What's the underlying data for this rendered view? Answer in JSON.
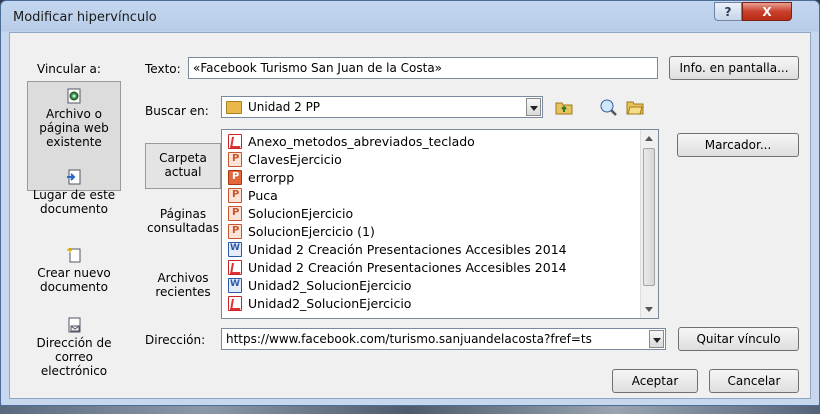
{
  "window": {
    "title": "Modificar hipervínculo",
    "help_label": "?",
    "close_label": "X"
  },
  "link_to": {
    "label": "Vincular a:",
    "items": [
      {
        "label_1": "Archivo o",
        "label_2": "página web",
        "label_3": "existente",
        "icon": "web-file-icon",
        "selected": true
      },
      {
        "label_1": "Lugar de este",
        "label_2": "documento",
        "icon": "document-place-icon",
        "selected": false
      },
      {
        "label_1": "Crear nuevo",
        "label_2": "documento",
        "icon": "new-document-icon",
        "selected": false
      },
      {
        "label_1": "Dirección de",
        "label_2": "correo",
        "label_3": "electrónico",
        "icon": "email-address-icon",
        "selected": false
      }
    ]
  },
  "text_field": {
    "label": "Texto:",
    "value": "«Facebook Turismo San Juan de la Costa»"
  },
  "screentip_button": "Info. en pantalla...",
  "look_in": {
    "label": "Buscar en:",
    "value": "Unidad 2 PP",
    "icons": [
      "up-folder-icon",
      "browse-web-icon",
      "browse-file-icon"
    ]
  },
  "view_tabs": [
    {
      "label_1": "Carpeta",
      "label_2": "actual",
      "selected": true
    },
    {
      "label_1": "Páginas",
      "label_2": "consultadas",
      "selected": false
    },
    {
      "label_1": "Archivos",
      "label_2": "recientes",
      "selected": false
    }
  ],
  "files": [
    {
      "name": "Anexo_metodos_abreviados_teclado",
      "icon": "pdf"
    },
    {
      "name": "ClavesEjercicio",
      "icon": "pptx"
    },
    {
      "name": "errorpp",
      "icon": "ppt"
    },
    {
      "name": "Puca",
      "icon": "pptx"
    },
    {
      "name": "SolucionEjercicio",
      "icon": "pptx"
    },
    {
      "name": "SolucionEjercicio (1)",
      "icon": "pptx"
    },
    {
      "name": "Unidad 2 Creación Presentaciones Accesibles 2014",
      "icon": "doc"
    },
    {
      "name": "Unidad 2 Creación Presentaciones Accesibles 2014",
      "icon": "pdf"
    },
    {
      "name": "Unidad2_SolucionEjercicio",
      "icon": "doc"
    },
    {
      "name": "Unidad2_SolucionEjercicio",
      "icon": "pdf"
    }
  ],
  "bookmark_button": "Marcador...",
  "address": {
    "label": "Dirección:",
    "value": "https://www.facebook.com/turismo.sanjuandelacosta?fref=ts"
  },
  "remove_link_button": "Quitar vínculo",
  "ok_button": "Aceptar",
  "cancel_button": "Cancelar"
}
